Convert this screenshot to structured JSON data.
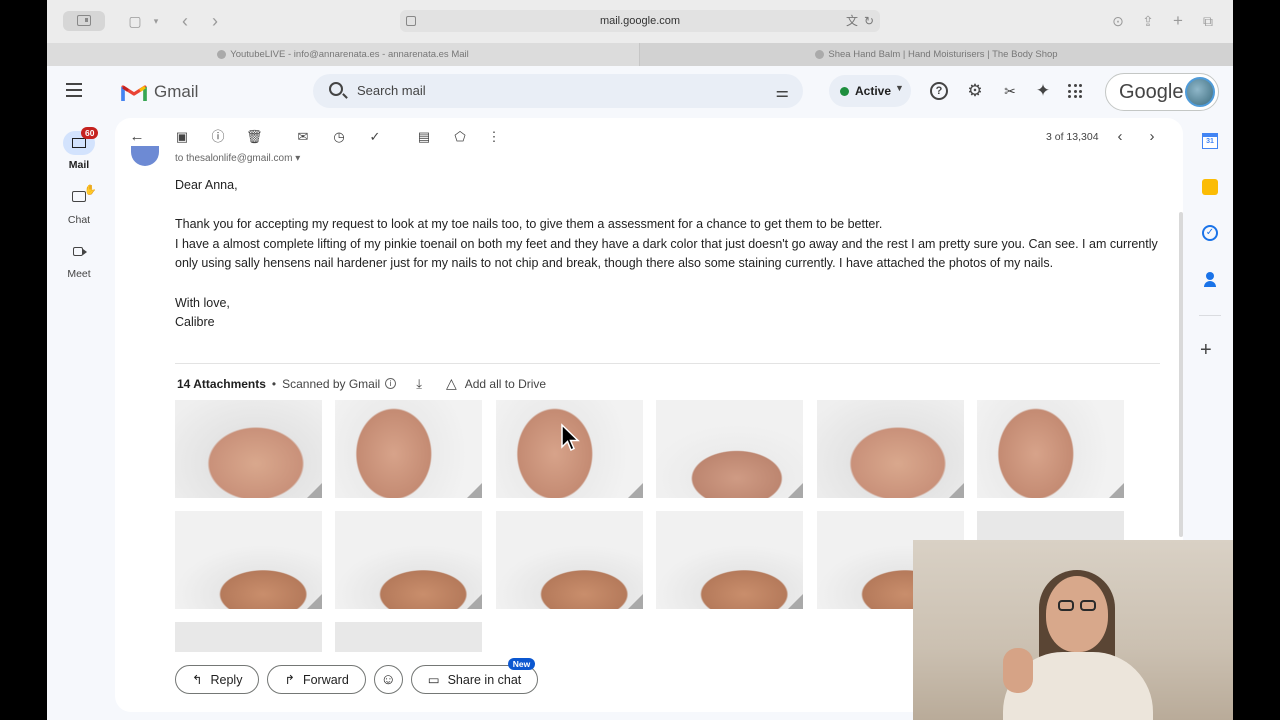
{
  "browser": {
    "url": "mail.google.com",
    "tabs": [
      {
        "label": "YoutubeLIVE - info@annarenata.es - annarenata.es Mail"
      },
      {
        "label": "Shea Hand Balm | Hand Moisturisers | The Body Shop"
      }
    ]
  },
  "gmail": {
    "logo_text": "Gmail",
    "search_placeholder": "Search mail",
    "status": "Active",
    "account_label": "Google"
  },
  "rail": {
    "mail_label": "Mail",
    "mail_badge": "60",
    "chat_label": "Chat",
    "meet_label": "Meet"
  },
  "toolbar": {
    "pager": "3 of 13,304"
  },
  "email": {
    "to_line": "to thesalonlife@gmail.com",
    "greeting": "Dear Anna,",
    "paragraph_1": "Thank you for accepting my request to look at my toe nails too, to give them a assessment for a chance to get them to be better.",
    "paragraph_2": "I have a almost complete lifting of my pinkie toenail on both my feet and they have a dark color that just doesn't go away and the rest I am pretty sure you. Can see. I am currently only using sally hensens nail hardener just for my nails to not chip and break, though there also some staining currently. I have attached the photos of my nails.",
    "closing": "With love,",
    "signature": "Calibre"
  },
  "attachments": {
    "count_label": "14 Attachments",
    "scanned_label": "Scanned by Gmail",
    "add_drive_label": "Add all to Drive"
  },
  "reply_bar": {
    "reply_label": "Reply",
    "forward_label": "Forward",
    "share_label": "Share in chat",
    "new_badge": "New"
  },
  "colors": {
    "gmail_bg": "#f6f8fc",
    "active_green": "#1e8e3e",
    "badge_red": "#c5221f",
    "accent_blue": "#0b57d0"
  }
}
